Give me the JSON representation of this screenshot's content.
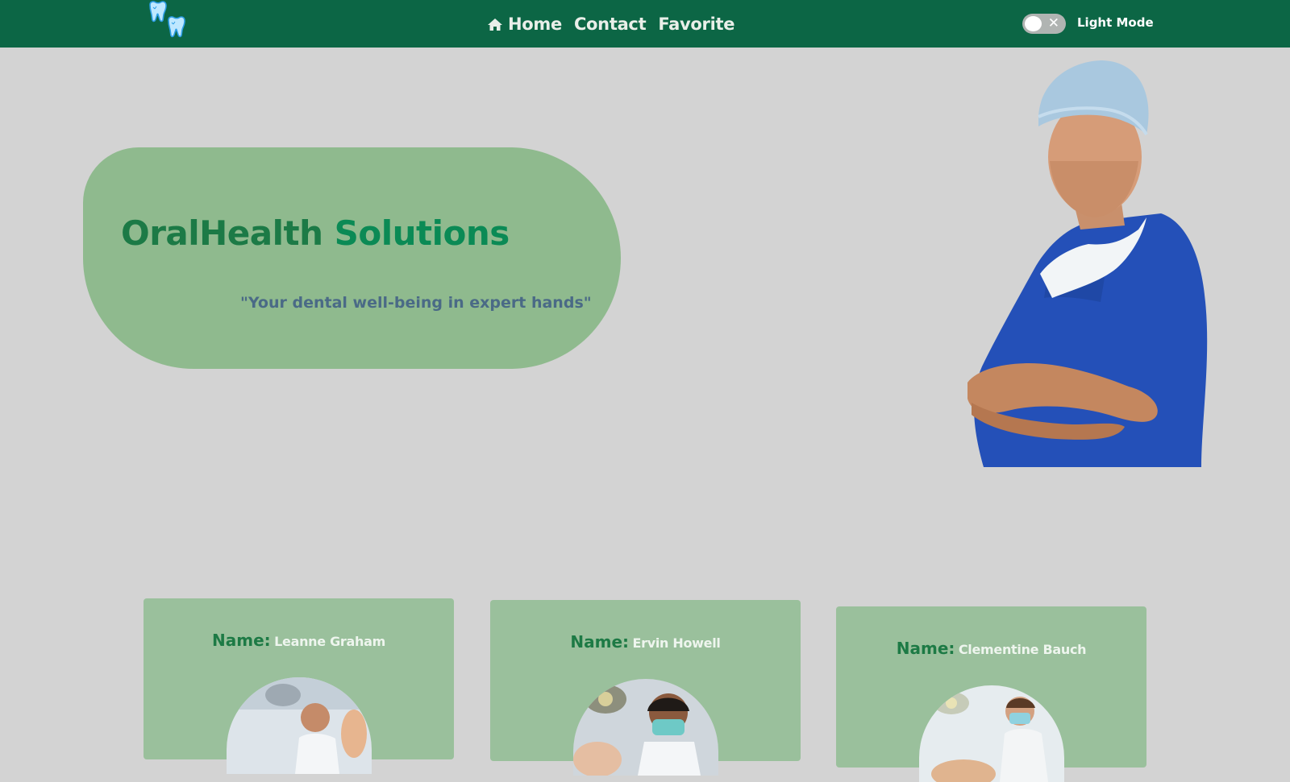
{
  "navbar": {
    "logo_icon": "teeth-logo-icon",
    "links": [
      {
        "label": "Home",
        "icon": "home-icon"
      },
      {
        "label": "Contact"
      },
      {
        "label": "Favorite"
      }
    ],
    "mode_toggle": {
      "state": "off",
      "icon": "close-icon"
    },
    "mode_label": "Light Mode"
  },
  "hero": {
    "title_part_1": "OralHealth",
    "title_part_2": "Solutions",
    "tagline": "\"Your dental well-being in expert hands\""
  },
  "team": {
    "name_label": "Name:",
    "members": [
      {
        "name": "Leanne Graham"
      },
      {
        "name": "Ervin Howell"
      },
      {
        "name": "Clementine Bauch"
      }
    ]
  },
  "colors": {
    "navbar_bg": "#0c6645",
    "page_bg": "#d3d3d3",
    "hero_card_bg": "#8fba8e",
    "team_card_bg": "#9ac09c",
    "accent_green": "#1c7a46"
  }
}
